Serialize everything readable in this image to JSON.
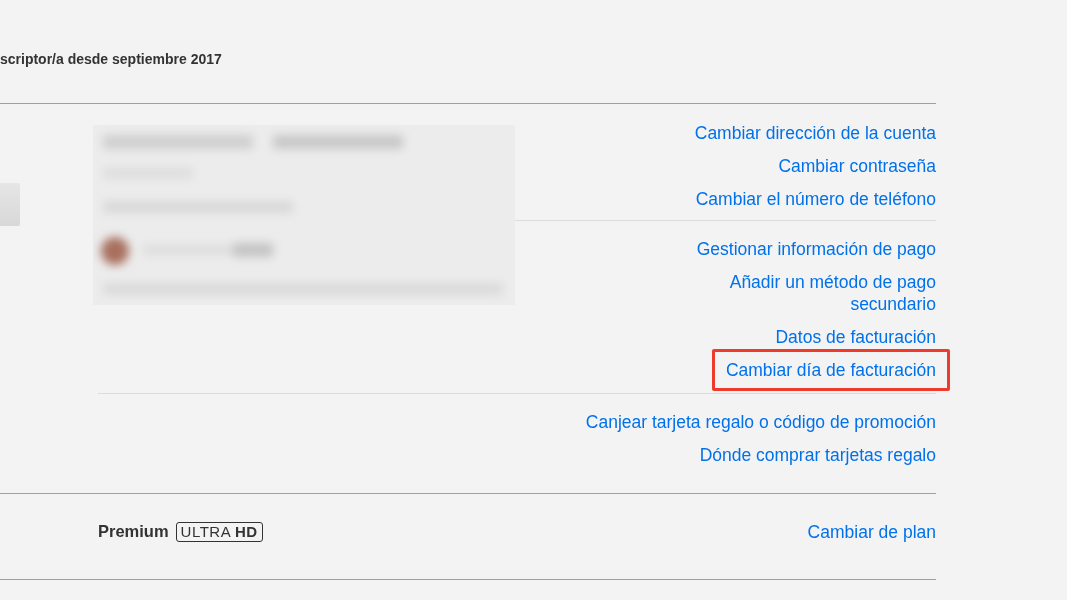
{
  "header": {
    "member_since": "scriptor/a desde septiembre 2017"
  },
  "membership": {
    "link_groups": [
      {
        "links": [
          {
            "label": "Cambiar dirección de la cuenta",
            "highlighted": false
          },
          {
            "label": "Cambiar contraseña",
            "highlighted": false
          },
          {
            "label": "Cambiar el número de teléfono",
            "highlighted": false
          }
        ]
      },
      {
        "links": [
          {
            "label": "Gestionar información de pago",
            "highlighted": false
          },
          {
            "label": "Añadir un método de pago secundario",
            "highlighted": false
          },
          {
            "label": "Datos de facturación",
            "highlighted": false
          },
          {
            "label": "Cambiar día de facturación",
            "highlighted": true
          }
        ]
      },
      {
        "links": [
          {
            "label": "Canjear tarjeta regalo o código de promoción",
            "highlighted": false
          },
          {
            "label": "Dónde comprar tarjetas regalo",
            "highlighted": false
          }
        ]
      }
    ]
  },
  "plan": {
    "name": "Premium",
    "badge": "ULTRA **HD**",
    "link": "Cambiar de plan"
  }
}
